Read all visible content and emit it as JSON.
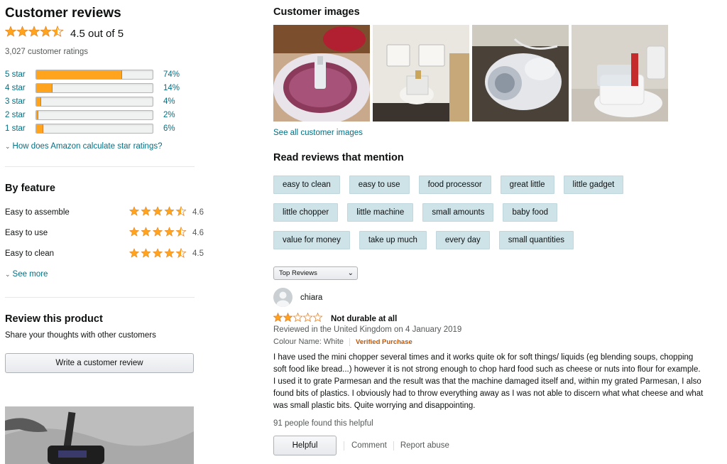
{
  "left": {
    "title": "Customer reviews",
    "rating_stars": "★★★★½",
    "rating_text": "4.5 out of 5",
    "total_ratings": "3,027 customer ratings",
    "histogram": [
      {
        "label": "5 star",
        "pct": "74%",
        "value": 74
      },
      {
        "label": "4 star",
        "pct": "14%",
        "value": 14
      },
      {
        "label": "3 star",
        "pct": "4%",
        "value": 4
      },
      {
        "label": "2 star",
        "pct": "2%",
        "value": 2
      },
      {
        "label": "1 star",
        "pct": "6%",
        "value": 6
      }
    ],
    "how_link": "How does Amazon calculate star ratings?",
    "by_feature_title": "By feature",
    "features": [
      {
        "name": "Easy to assemble",
        "value": "4.6"
      },
      {
        "name": "Easy to use",
        "value": "4.6"
      },
      {
        "name": "Easy to clean",
        "value": "4.5"
      }
    ],
    "see_more": "See more",
    "review_title": "Review this product",
    "review_sub": "Share your thoughts with other customers",
    "write_button": "Write a customer review"
  },
  "right": {
    "images_title": "Customer images",
    "see_all_images": "See all customer images",
    "mentions_title": "Read reviews that mention",
    "chip_rows": [
      [
        "easy to clean",
        "easy to use",
        "food processor",
        "great little",
        "little gadget"
      ],
      [
        "little chopper",
        "little machine",
        "small amounts",
        "baby food"
      ],
      [
        "value for money",
        "take up much",
        "every day",
        "small quantities"
      ]
    ],
    "sort_value": "Top Reviews",
    "review": {
      "reviewer": "chiara",
      "stars": 2,
      "title": "Not durable at all",
      "meta": "Reviewed in the United Kingdom on 4 January 2019",
      "variant": "Colour Name: White",
      "verified": "Verified Purchase",
      "body": "I have used the mini chopper several times and it works quite ok for soft things/ liquids (eg blending soups, chopping soft food like bread...) however it is not strong enough to chop hard food such as cheese or nuts into flour for example. I used it to grate Parmesan and the result was that the machine damaged itself and, within my grated Parmesan, I also found bits of plastics. I obviously had to throw everything away as I was not able to discern what what cheese and what was small plastic bits. Quite worrying and disappointing.",
      "helpful_count": "91 people found this helpful",
      "helpful_button": "Helpful",
      "comment": "Comment",
      "report": "Report abuse"
    }
  }
}
